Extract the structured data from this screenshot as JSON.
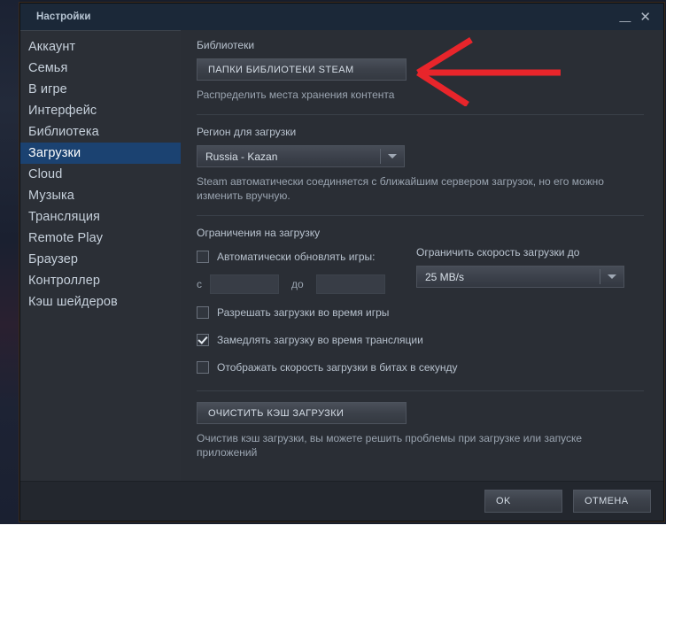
{
  "window": {
    "title": "Настройки",
    "minimize_icon": "minimize-icon",
    "close_icon": "close-icon"
  },
  "sidebar": {
    "items": [
      {
        "label": "Аккаунт",
        "selected": false
      },
      {
        "label": "Семья",
        "selected": false
      },
      {
        "label": "В игре",
        "selected": false
      },
      {
        "label": "Интерфейс",
        "selected": false
      },
      {
        "label": "Библиотека",
        "selected": false
      },
      {
        "label": "Загрузки",
        "selected": true
      },
      {
        "label": "Cloud",
        "selected": false
      },
      {
        "label": "Музыка",
        "selected": false
      },
      {
        "label": "Трансляция",
        "selected": false
      },
      {
        "label": "Remote Play",
        "selected": false
      },
      {
        "label": "Браузер",
        "selected": false
      },
      {
        "label": "Контроллер",
        "selected": false
      },
      {
        "label": "Кэш шейдеров",
        "selected": false
      }
    ]
  },
  "content": {
    "libraries": {
      "section_label": "Библиотеки",
      "button_label": "ПАПКИ БИБЛИОТЕКИ STEAM",
      "hint": "Распределить места хранения контента"
    },
    "region": {
      "section_label": "Регион для загрузки",
      "selected_value": "Russia - Kazan",
      "hint": "Steam автоматически соединяется с ближайшим сервером загрузок, но его можно изменить вручную."
    },
    "restrictions": {
      "section_label": "Ограничения на загрузку",
      "auto_update_label": "Автоматически обновлять игры:",
      "auto_update_checked": false,
      "time_from_word": "с",
      "time_from_value": "",
      "time_to_word": "до",
      "time_to_value": "",
      "allow_downloads_while_playing_label": "Разрешать загрузки во время игры",
      "allow_downloads_while_playing_checked": false,
      "throttle_while_streaming_label": "Замедлять загрузку во время трансляции",
      "throttle_while_streaming_checked": true,
      "show_bits_label": "Отображать скорость загрузки в битах в секунду",
      "show_bits_checked": false,
      "speed_limit_label": "Ограничить скорость загрузки до",
      "speed_limit_value": "25 MB/s"
    },
    "cache": {
      "button_label": "ОЧИСТИТЬ КЭШ ЗАГРУЗКИ",
      "hint": "Очистив кэш загрузки, вы можете решить проблемы при загрузке или запуске приложений"
    }
  },
  "footer": {
    "ok_label": "OK",
    "cancel_label": "ОТМЕНА"
  },
  "annotation": {
    "arrow_color": "#e8252b",
    "direction": "left"
  },
  "colors": {
    "accent_selected": "#1b4271",
    "titlebar": "#1b2838",
    "window_bg": "#2a2e35",
    "sidebar_bg": "#2b2f36",
    "footer_bg": "#23272e",
    "annotation_red": "#e8252b"
  }
}
